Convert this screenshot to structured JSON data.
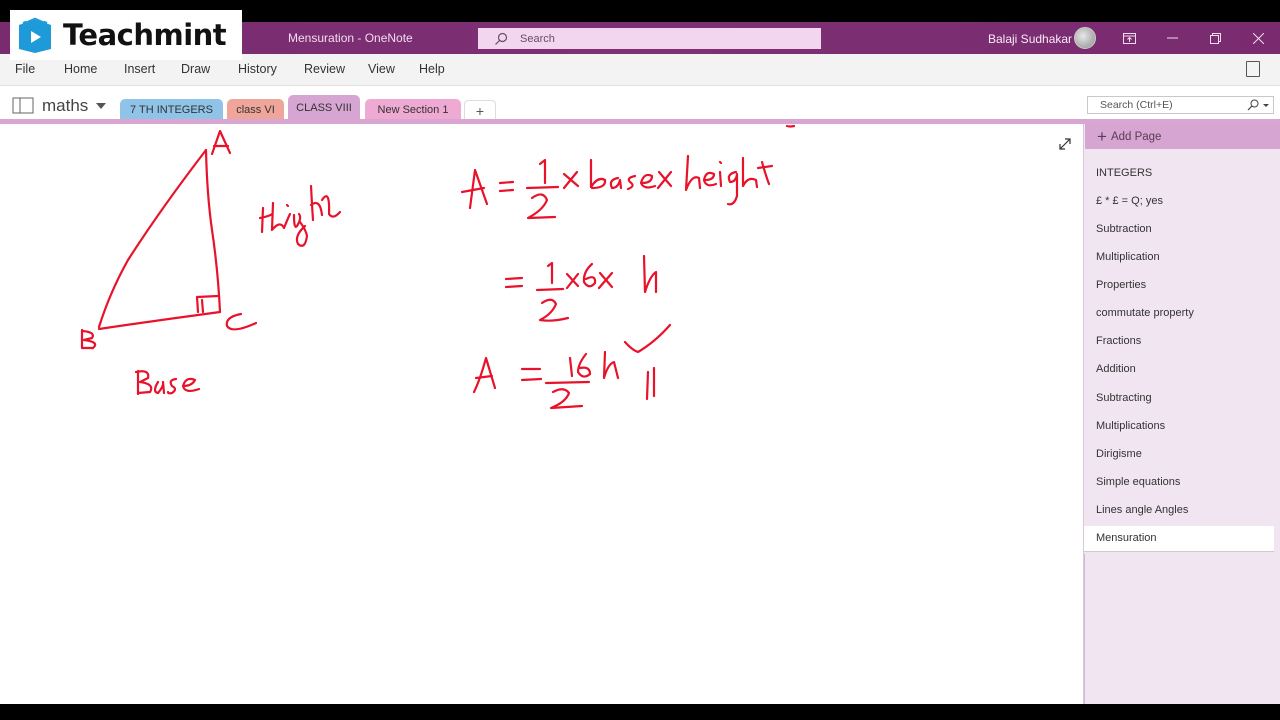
{
  "overlay": {
    "brand_name": "Teachmint",
    "brand_color": "#1f9ad8"
  },
  "titlebar": {
    "document_title": "Mensuration  -  OneNote",
    "search_placeholder": "Search",
    "user_name": "Balaji Sudhakar",
    "color": "#7b2d72"
  },
  "menu": {
    "items": [
      "File",
      "Home",
      "Insert",
      "Draw",
      "History",
      "Review",
      "View",
      "Help"
    ]
  },
  "notebook": {
    "name": "maths",
    "sections": [
      {
        "label": "7 TH INTEGERS",
        "color": "#8fc3e8"
      },
      {
        "label": "class VI",
        "color": "#f0a59a"
      },
      {
        "label": "CLASS VIII",
        "color": "#d7a5d2",
        "active": true
      },
      {
        "label": "New Section 1",
        "color": "#eeaad2"
      }
    ],
    "add_section_label": "+",
    "search_placeholder": "Search (Ctrl+E)"
  },
  "pages": {
    "add_page_label": "Add Page",
    "items": [
      "INTEGERS",
      "£ * £ = Q; yes",
      "Subtraction",
      "Multiplication",
      "Properties",
      "commutate property",
      "Fractions",
      "Addition",
      "Subtracting",
      "Multiplications",
      "Dirigisme",
      "Simple equations",
      "Lines angle Angles",
      "Mensuration"
    ],
    "selected": "Mensuration"
  },
  "ink": {
    "color": "#e8122a",
    "triangle_labels": {
      "a": "A",
      "b": "B",
      "c": "C"
    },
    "side_labels": {
      "height": "Height",
      "base": "Base"
    },
    "equations": [
      "A = 1/2 × base × height",
      "= 1/2 × 6 × h",
      "A = 6h/2"
    ]
  }
}
